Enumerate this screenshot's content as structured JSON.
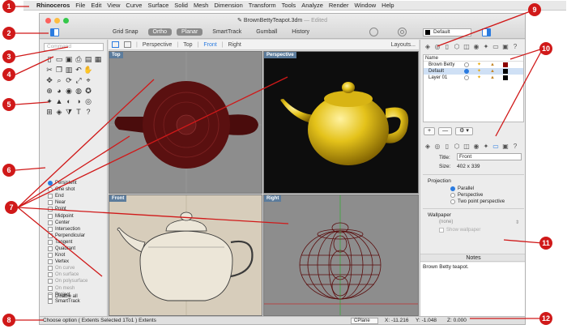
{
  "menubar": {
    "app": "Rhinoceros",
    "items": [
      "File",
      "Edit",
      "View",
      "Curve",
      "Surface",
      "Solid",
      "Mesh",
      "Dimension",
      "Transform",
      "Tools",
      "Analyze",
      "Render",
      "Window",
      "Help"
    ]
  },
  "window": {
    "title": "BrownBettyTeapot.3dm",
    "edited": "— Edited",
    "modes": [
      "Grid Snap",
      "Ortho",
      "Planar",
      "SmartTrack",
      "Gumball",
      "History"
    ],
    "active_modes": [
      "Ortho",
      "Planar"
    ],
    "layer": "Default"
  },
  "command": {
    "placeholder": "Command"
  },
  "viewport_tabs": {
    "tabs": [
      "Perspective",
      "Top",
      "Front",
      "Right"
    ],
    "active": "Front",
    "layouts": "Layouts..."
  },
  "viewports": {
    "top": "Top",
    "perspective": "Perspective",
    "front": "Front",
    "right": "Right"
  },
  "osnap": {
    "items": [
      {
        "label": "Persistent",
        "type": "radio",
        "state": "on"
      },
      {
        "label": "One shot",
        "type": "radio",
        "state": "off"
      },
      {
        "label": "End",
        "type": "check",
        "state": "off"
      },
      {
        "label": "Near",
        "type": "check",
        "state": "off"
      },
      {
        "label": "Point",
        "type": "check",
        "state": "off"
      },
      {
        "label": "Midpoint",
        "type": "check",
        "state": "off"
      },
      {
        "label": "Center",
        "type": "check",
        "state": "off"
      },
      {
        "label": "Intersection",
        "type": "check",
        "state": "off"
      },
      {
        "label": "Perpendicular",
        "type": "check",
        "state": "off"
      },
      {
        "label": "Tangent",
        "type": "check",
        "state": "off"
      },
      {
        "label": "Quadrant",
        "type": "check",
        "state": "off"
      },
      {
        "label": "Knot",
        "type": "check",
        "state": "off"
      },
      {
        "label": "Vertex",
        "type": "check",
        "state": "off"
      },
      {
        "label": "On curve",
        "type": "check",
        "state": "dim"
      },
      {
        "label": "On surface",
        "type": "check",
        "state": "dim"
      },
      {
        "label": "On polysurface",
        "type": "check",
        "state": "dim"
      },
      {
        "label": "On mesh",
        "type": "check",
        "state": "dim"
      },
      {
        "label": "Project",
        "type": "check",
        "state": "off"
      },
      {
        "label": "SmartTrack",
        "type": "check",
        "state": "off"
      }
    ],
    "disable_all": "Disable all"
  },
  "layers": {
    "header": "Name",
    "rows": [
      {
        "name": "Brown Betty",
        "current": false,
        "color": "#8b0000",
        "selected": false
      },
      {
        "name": "Default",
        "current": true,
        "color": "#000000",
        "selected": true
      },
      {
        "name": "Layer 01",
        "current": false,
        "color": "#000000",
        "selected": false
      }
    ],
    "add": "+",
    "remove": "—",
    "gear": "⚙ ▾"
  },
  "properties": {
    "title_label": "Title:",
    "title_value": "Front",
    "size_label": "Size:",
    "size_value": "402 x 339",
    "projection": "Projection",
    "options": [
      {
        "label": "Parallel",
        "on": true
      },
      {
        "label": "Perspective",
        "on": false
      },
      {
        "label": "Two point perspective",
        "on": false
      }
    ],
    "wallpaper": "Wallpaper",
    "wallpaper_value": "(none)",
    "show_wallpaper": "Show wallpaper"
  },
  "notes": {
    "header": "Notes",
    "text": "Brown Betty teapot."
  },
  "status": {
    "message": "Choose option ( Extents Selected 1To1 ) Extents",
    "cplane": "CPlane",
    "x": "X: -11.216",
    "y": "Y: -1.048",
    "z": "Z: 0.000"
  },
  "callouts": [
    "1",
    "2",
    "3",
    "4",
    "5",
    "6",
    "7",
    "8",
    "9",
    "10",
    "11",
    "12"
  ],
  "colors": {
    "accent": "#2a7be0",
    "badge": "#d01919",
    "teapot_top": "#5a1010",
    "teapot_gold": "#e4c21a"
  }
}
